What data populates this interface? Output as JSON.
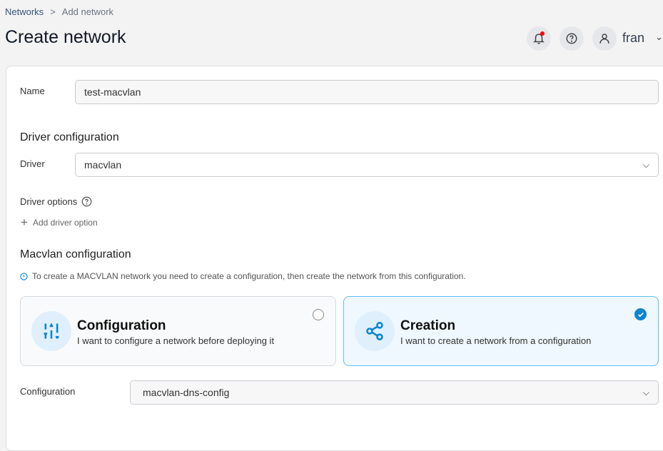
{
  "breadcrumb": {
    "parent": "Networks",
    "separator": ">",
    "current": "Add network"
  },
  "page_title": "Create network",
  "header": {
    "user": "fran",
    "icons": [
      "bell-icon",
      "help-icon",
      "user-icon"
    ],
    "notification_color": "#ff0000"
  },
  "form": {
    "name_label": "Name",
    "name_value": "test-macvlan",
    "driver_section": "Driver configuration",
    "driver_label": "Driver",
    "driver_value": "macvlan",
    "driver_options_label": "Driver options",
    "add_driver_option": "Add driver option",
    "macvlan_section": "Macvlan configuration",
    "macvlan_info": "To create a MACVLAN network you need to create a configuration, then create the network from this configuration.",
    "options": [
      {
        "title": "Configuration",
        "description": "I want to configure a network before deploying it",
        "selected": false,
        "icon": "sliders-icon"
      },
      {
        "title": "Creation",
        "description": "I want to create a network from a configuration",
        "selected": true,
        "icon": "share-icon"
      }
    ],
    "configuration_label": "Configuration",
    "configuration_value": "macvlan-dns-config"
  },
  "colors": {
    "accent": "#0a84d0",
    "selected_border": "#5cc0ee"
  }
}
